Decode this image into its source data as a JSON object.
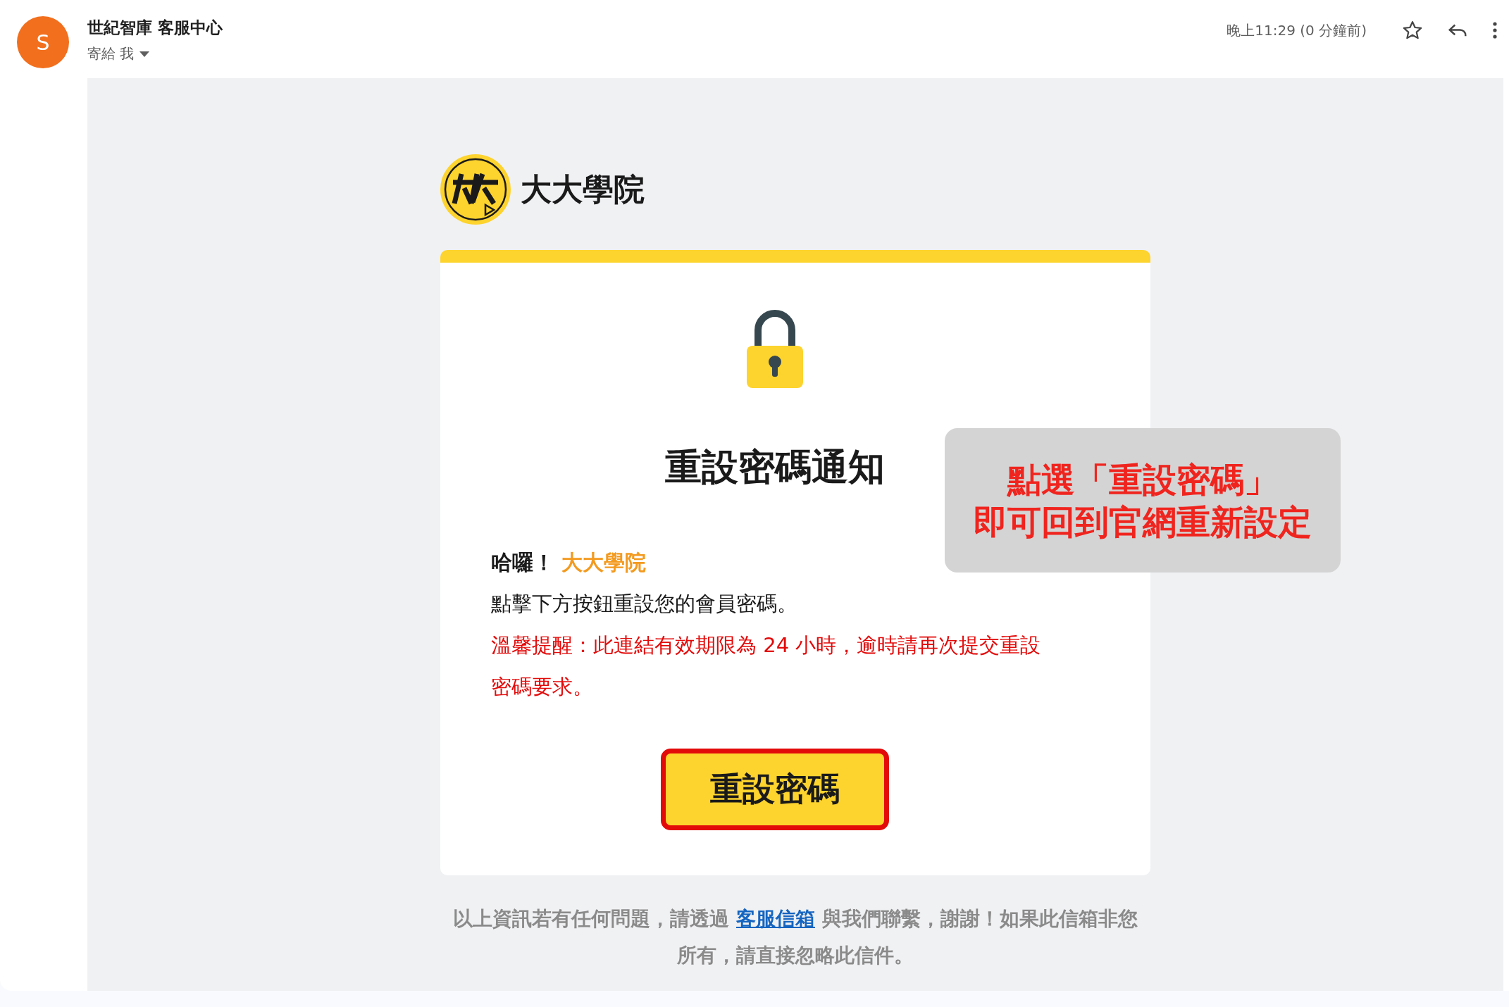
{
  "header": {
    "avatar_letter": "S",
    "sender": "世紀智庫 客服中心",
    "recipient": "寄給 我",
    "timestamp": "晚上11:29 (0 分鐘前)"
  },
  "email": {
    "brand": "大大學院",
    "title": "重設密碼通知",
    "greeting": "哈囉！",
    "greeting_name": "大大學院",
    "instruction": "點擊下方按鈕重設您的會員密碼。",
    "reminder": "溫馨提醒：此連結有效期限為 24 小時，逾時請再次提交重設密碼要求。",
    "button": "重設密碼",
    "footer_before": "以上資訊若有任何問題，請透過",
    "footer_link": "客服信箱",
    "footer_after": "與我們聯繫，謝謝！如果此信箱非您所有，請直接忽略此信件。"
  },
  "callout": {
    "lines": [
      "點選「重設密碼」",
      "即可回到官網重新設定"
    ]
  }
}
